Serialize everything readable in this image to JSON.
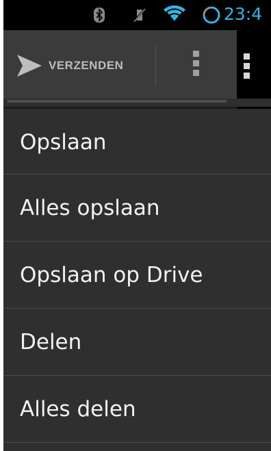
{
  "status_bar": {
    "time": "23:4",
    "icons": [
      "bluetooth-icon",
      "muted-vibrate-icon",
      "wifi-icon",
      "sync-icon"
    ],
    "accent_color": "#33b5e5"
  },
  "action_bar": {
    "send_label": "VERZENDEN",
    "send_icon": "send-icon",
    "overflow_icon": "overflow-menu-icon"
  },
  "menu": {
    "items": [
      {
        "label": "Opslaan"
      },
      {
        "label": "Alles opslaan"
      },
      {
        "label": "Opslaan op Drive"
      },
      {
        "label": "Delen"
      },
      {
        "label": "Alles delen"
      }
    ]
  }
}
